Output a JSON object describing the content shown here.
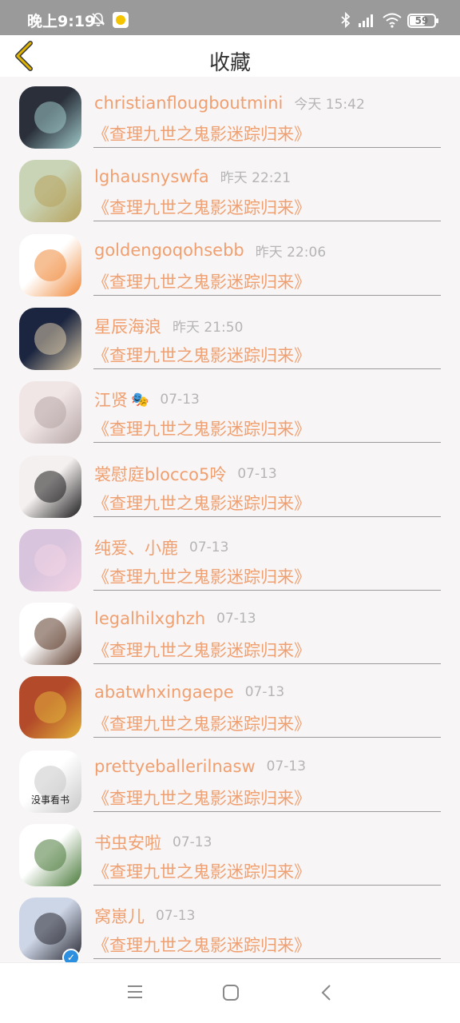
{
  "status_bar": {
    "time": "晚上9:19",
    "battery": "59",
    "icons": [
      "bell-off-icon",
      "qq-app-icon",
      "bluetooth-icon",
      "signal-icon",
      "wifi-icon",
      "battery-icon"
    ]
  },
  "header": {
    "title": "收藏",
    "back_icon": "chevron-left-icon"
  },
  "colors": {
    "accent": "#f0a070",
    "time_text": "#b5b5b5",
    "back_arrow": "#e0b400",
    "divider": "#9a9a9a"
  },
  "items": [
    {
      "name": "christianflougboutmini",
      "time": "今天 15:42",
      "book": "《查理九世之鬼影迷踪归来》",
      "avatar": [
        "#2a2f3a",
        "#9fc9c8"
      ]
    },
    {
      "name": "lghausnyswfa",
      "time": "昨天 22:21",
      "book": "《查理九世之鬼影迷踪归来》",
      "avatar": [
        "#c9d3b5",
        "#b7a25c"
      ]
    },
    {
      "name": "goldengoqohsebb",
      "time": "昨天 22:06",
      "book": "《查理九世之鬼影迷踪归来》",
      "avatar": [
        "#ffffff",
        "#f08a3c"
      ]
    },
    {
      "name": "星辰海浪",
      "time": "昨天 21:50",
      "book": "《查理九世之鬼影迷踪归来》",
      "avatar": [
        "#1b2540",
        "#d9c9a8"
      ]
    },
    {
      "name": "江贤",
      "time": "07-13",
      "book": "《查理九世之鬼影迷踪归来》",
      "avatar": [
        "#f1e6e6",
        "#b6a6a6"
      ],
      "mask": "🎭"
    },
    {
      "name": "裳慰庭blocco5呤",
      "time": "07-13",
      "book": "《查理九世之鬼影迷踪归来》",
      "avatar": [
        "#f5f0f0",
        "#1c1c1c"
      ]
    },
    {
      "name": "纯爱、小鹿",
      "time": "07-13",
      "book": "《查理九世之鬼影迷踪归来》",
      "avatar": [
        "#d8c4dd",
        "#f3d3e4"
      ]
    },
    {
      "name": "legalhilxghzh",
      "time": "07-13",
      "book": "《查理九世之鬼影迷踪归来》",
      "avatar": [
        "#ffffff",
        "#5c3a2a"
      ]
    },
    {
      "name": "abatwhxingaepe",
      "time": "07-13",
      "book": "《查理九世之鬼影迷踪归来》",
      "avatar": [
        "#b34a2a",
        "#e2b33a"
      ]
    },
    {
      "name": "prettyeballerilnasw",
      "time": "07-13",
      "book": "《查理九世之鬼影迷踪归来》",
      "avatar": [
        "#ffffff",
        "#c8c8c8"
      ],
      "avatar_text": "没事看书"
    },
    {
      "name": "书虫安啦",
      "time": "07-13",
      "book": "《查理九世之鬼影迷踪归来》",
      "avatar": [
        "#ffffff",
        "#4a7a3a"
      ]
    },
    {
      "name": "窝崽儿",
      "time": "07-13",
      "book": "《查理九世之鬼影迷踪归来》",
      "avatar": [
        "#cdd6e6",
        "#2a2a33"
      ],
      "verified": true
    }
  ],
  "nav": {
    "icons": [
      "menu-icon",
      "home-icon",
      "back-icon"
    ]
  }
}
